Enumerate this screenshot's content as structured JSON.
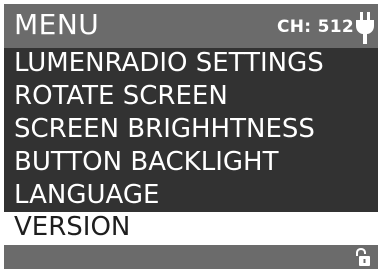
{
  "header": {
    "title": "MENU",
    "channel": "CH: 512",
    "power_icon": "power-plug-icon"
  },
  "menu": {
    "items": [
      {
        "label": "LUMENRADIO SETTINGS"
      },
      {
        "label": "ROTATE SCREEN"
      },
      {
        "label": "SCREEN BRIGHHTNESS"
      },
      {
        "label": "BUTTON BACKLIGHT"
      },
      {
        "label": "LANGUAGE"
      },
      {
        "label": "VERSION"
      }
    ],
    "selected": "VERSION"
  },
  "footer": {
    "lock_icon": "unlocked-padlock-icon"
  },
  "colors": {
    "header_bg": "#6b6b6b",
    "list_bg": "#323232",
    "selected_bg": "#ffffff",
    "text": "#ffffff",
    "selected_text": "#1e1e1e"
  }
}
